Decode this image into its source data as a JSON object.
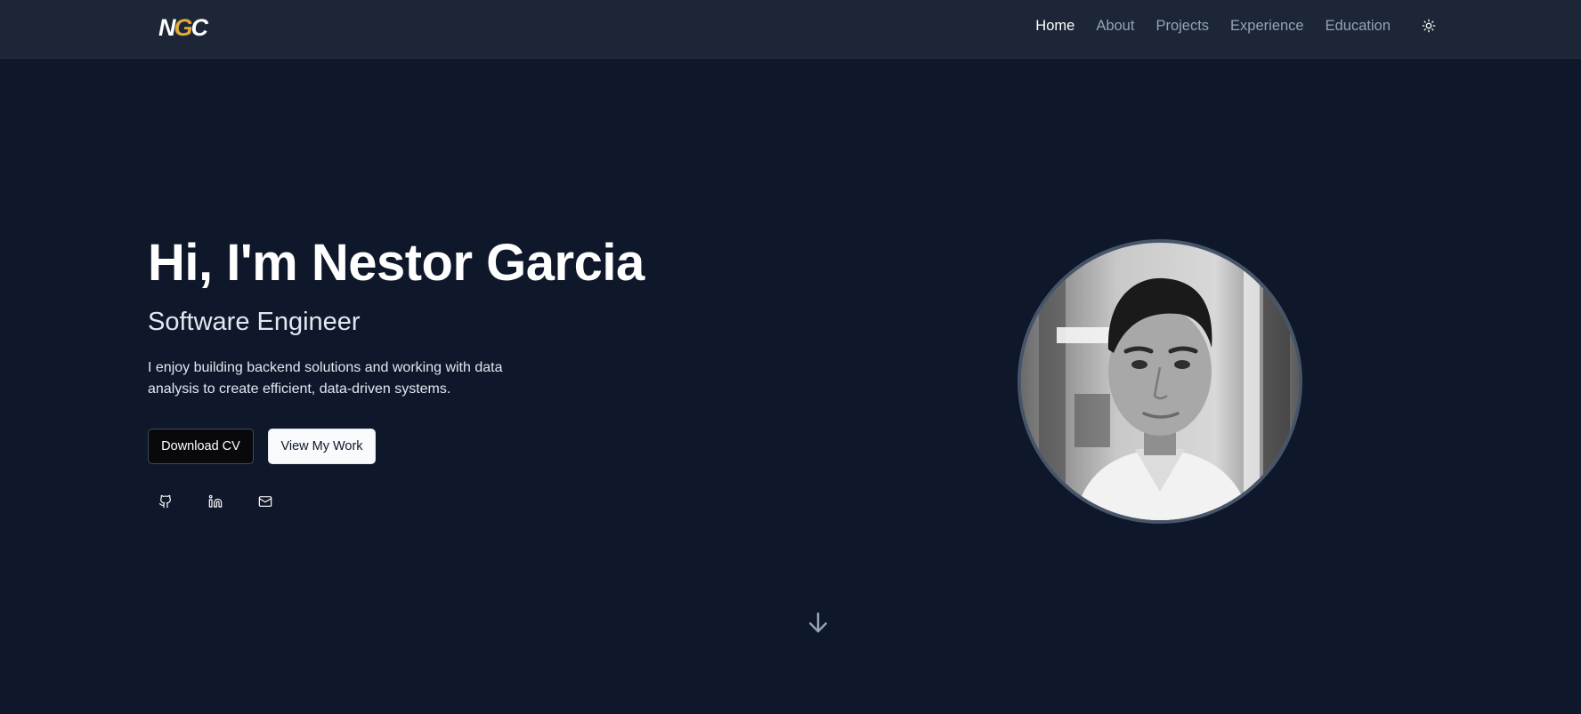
{
  "brand": {
    "logo_prefix": "N",
    "logo_accent": "G",
    "logo_suffix": "C",
    "accent_color": "#e2a93b"
  },
  "nav": {
    "items": [
      {
        "label": "Home",
        "active": true
      },
      {
        "label": "About",
        "active": false
      },
      {
        "label": "Projects",
        "active": false
      },
      {
        "label": "Experience",
        "active": false
      },
      {
        "label": "Education",
        "active": false
      }
    ],
    "theme_toggle_icon": "sun-icon"
  },
  "hero": {
    "title": "Hi, I'm Nestor Garcia",
    "subtitle": "Software Engineer",
    "description": "I enjoy building backend solutions and working with data analysis to create efficient, data-driven systems.",
    "primary_button": "Download CV",
    "secondary_button": "View My Work",
    "socials": [
      {
        "icon": "github-icon"
      },
      {
        "icon": "linkedin-icon"
      },
      {
        "icon": "mail-icon"
      }
    ],
    "avatar_icon": "profile-photo"
  },
  "scroll": {
    "icon": "arrow-down-icon"
  },
  "colors": {
    "background": "#0f172a",
    "navbar": "#1c2636",
    "muted_text": "#94a3b8"
  }
}
